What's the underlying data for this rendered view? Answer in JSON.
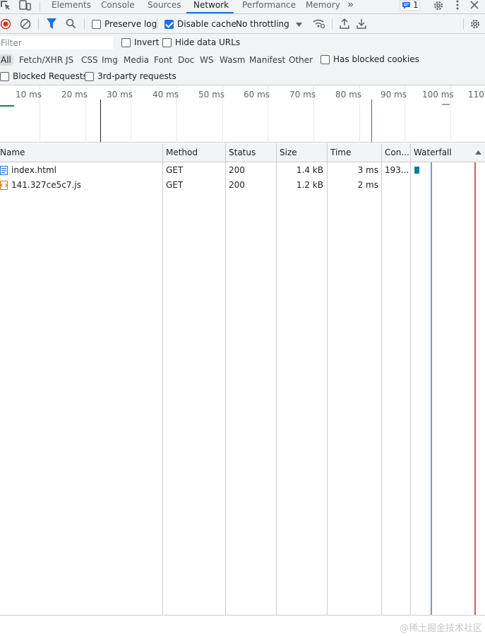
{
  "tabs": [
    {
      "label": "Elements",
      "active": false
    },
    {
      "label": "Console",
      "active": false
    },
    {
      "label": "Sources",
      "active": false
    },
    {
      "label": "Network",
      "active": true
    },
    {
      "label": "Performance",
      "active": false
    },
    {
      "label": "Memory",
      "active": false
    }
  ],
  "issues_badge": "1",
  "toolbar": {
    "preserve_log": "Preserve log",
    "disable_cache": "Disable cache",
    "throttling": "No throttling"
  },
  "filter": {
    "placeholder": "Filter",
    "invert": "Invert",
    "hide_data_urls": "Hide data URLs"
  },
  "types": [
    "All",
    "Fetch/XHR",
    "JS",
    "CSS",
    "Img",
    "Media",
    "Font",
    "Doc",
    "WS",
    "Wasm",
    "Manifest",
    "Other"
  ],
  "has_blocked_cookies": "Has blocked cookies",
  "blocked_requests": "Blocked Requests",
  "third_party": "3rd-party requests",
  "timeline_ticks": [
    "10 ms",
    "20 ms",
    "30 ms",
    "40 ms",
    "50 ms",
    "60 ms",
    "70 ms",
    "80 ms",
    "90 ms",
    "100 ms",
    "110"
  ],
  "columns": {
    "name": "Name",
    "method": "Method",
    "status": "Status",
    "size": "Size",
    "time": "Time",
    "connection": "Con...",
    "waterfall": "Waterfall"
  },
  "requests": [
    {
      "name": "index.html",
      "method": "GET",
      "status": "200",
      "size": "1.4 kB",
      "time": "3 ms",
      "connection": "193...",
      "type": "document"
    },
    {
      "name": "141.327ce5c7.js",
      "method": "GET",
      "status": "200",
      "size": "1.2 kB",
      "time": "2 ms",
      "connection": "",
      "type": "script"
    }
  ],
  "watermark": "@稀土掘金技术社区",
  "colors": {
    "accent": "#1a73e8",
    "record": "#d93025",
    "load_line": "#d93025",
    "dcl_line": "#1a73e8"
  }
}
